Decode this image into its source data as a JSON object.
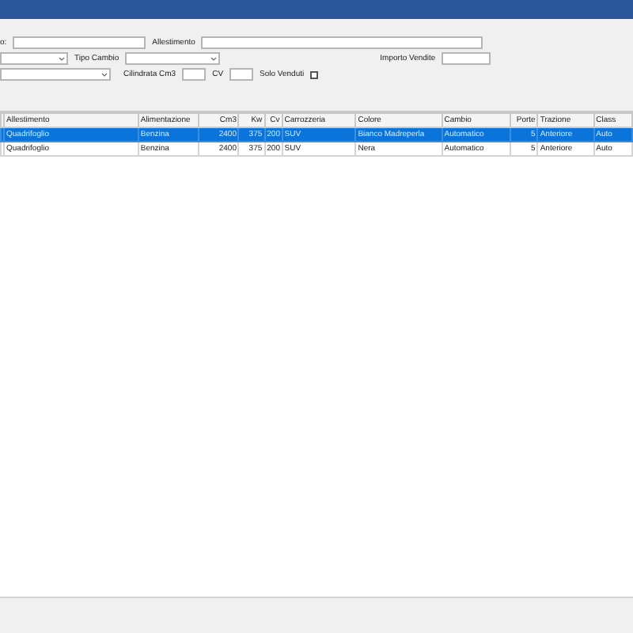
{
  "form": {
    "row1": [
      {
        "kind": "label",
        "text": "o:"
      },
      {
        "kind": "input"
      },
      {
        "kind": "label",
        "text": "Allestimento"
      },
      {
        "kind": "input"
      }
    ],
    "row2": [
      {
        "kind": "combo"
      },
      {
        "kind": "label",
        "text": "Tipo Cambio"
      },
      {
        "kind": "combo"
      },
      {
        "kind": "spacer"
      },
      {
        "kind": "label",
        "text": "Importo Vendite"
      },
      {
        "kind": "input"
      }
    ],
    "row3": [
      {
        "kind": "combo"
      },
      {
        "kind": "label",
        "text": "Cilindrata Cm3"
      },
      {
        "kind": "input"
      },
      {
        "kind": "label",
        "text": "CV"
      },
      {
        "kind": "input"
      },
      {
        "kind": "label",
        "text": "Solo Venduti"
      },
      {
        "kind": "checkbox",
        "checked": false
      }
    ]
  },
  "table": {
    "columns": [
      "Allestimento",
      "Alimentazione",
      "Cm3",
      "Kw",
      "Cv",
      "Carrozzeria",
      "Colore",
      "Cambio",
      "Porte",
      "Trazione",
      "Class"
    ],
    "rows": [
      {
        "selected": true,
        "cells": [
          "Quadrifoglio",
          "Benzina",
          "2400",
          "375",
          "200",
          "SUV",
          "Bianco Madreperla",
          "Automatico",
          "5",
          "Anteriore",
          "Auto"
        ]
      },
      {
        "selected": false,
        "cells": [
          "Quadrifoglio",
          "Benzina",
          "2400",
          "375",
          "200",
          "SUV",
          "Nera",
          "Automatico",
          "5",
          "Anteriore",
          "Auto"
        ]
      }
    ]
  }
}
